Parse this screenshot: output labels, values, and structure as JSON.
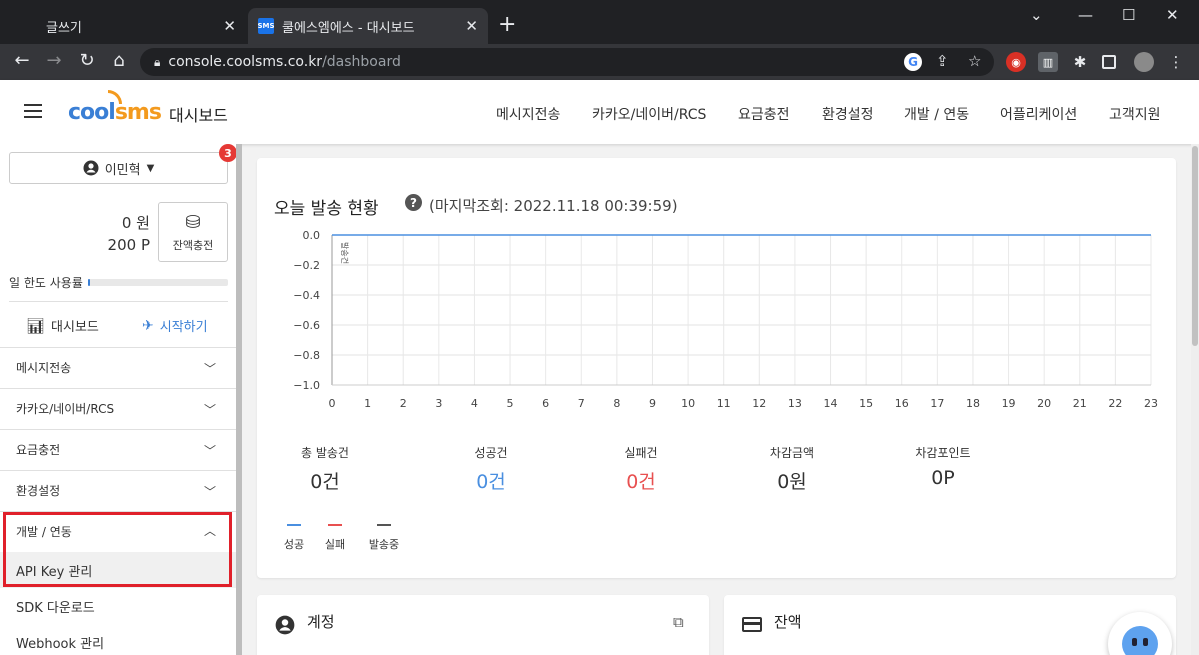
{
  "browser": {
    "tabs": [
      {
        "title": "글쓰기",
        "active": false
      },
      {
        "title": "쿨에스엠에스 - 대시보드",
        "active": true,
        "favicon": "SMS"
      }
    ],
    "url_host": "console.coolsms.co.kr",
    "url_path": "/dashboard"
  },
  "header": {
    "logo_cool": "cool",
    "logo_sms": "sms",
    "title": "대시보드",
    "nav": [
      "메시지전송",
      "카카오/네이버/RCS",
      "요금충전",
      "환경설정",
      "개발 / 연동",
      "어플리케이션",
      "고객지원"
    ]
  },
  "sidebar": {
    "user_name": "이민혁",
    "notification_count": "3",
    "balance_won": "0 원",
    "balance_point": "200 P",
    "recharge_label": "잔액충전",
    "daily_limit_label": "일 한도 사용률",
    "daily_limit_fraction": 0.015,
    "dashboard_label": "대시보드",
    "getting_started_label": "시작하기",
    "menu": [
      {
        "label": "메시지전송",
        "expanded": false
      },
      {
        "label": "카카오/네이버/RCS",
        "expanded": false
      },
      {
        "label": "요금충전",
        "expanded": false
      },
      {
        "label": "환경설정",
        "expanded": false
      },
      {
        "label": "개발 / 연동",
        "expanded": true
      }
    ],
    "submenu": [
      "API Key 관리",
      "SDK 다운로드",
      "Webhook 관리"
    ]
  },
  "status_card": {
    "title": "오늘 발송 현황",
    "last_query": "(마지막조회: 2022.11.18 00:39:59)",
    "stats": [
      {
        "label": "총 발송건",
        "value": "0건",
        "color": "#333333"
      },
      {
        "label": "성공건",
        "value": "0건",
        "color": "#4a8fe0"
      },
      {
        "label": "실패건",
        "value": "0건",
        "color": "#e85050"
      },
      {
        "label": "차감금액",
        "value": "0원",
        "color": "#333333"
      },
      {
        "label": "차감포인트",
        "value": "0P",
        "color": "#333333"
      }
    ],
    "legend": [
      {
        "name": "성공",
        "color": "#4a8fe0"
      },
      {
        "name": "실패",
        "color": "#e85050"
      },
      {
        "name": "발송중",
        "color": "#555555"
      }
    ]
  },
  "chart_data": {
    "type": "line",
    "x": [
      0,
      1,
      2,
      3,
      4,
      5,
      6,
      7,
      8,
      9,
      10,
      11,
      12,
      13,
      14,
      15,
      16,
      17,
      18,
      19,
      20,
      21,
      22,
      23
    ],
    "series": [
      {
        "name": "성공",
        "color": "#4a8fe0",
        "values": [
          0,
          0,
          0,
          0,
          0,
          0,
          0,
          0,
          0,
          0,
          0,
          0,
          0,
          0,
          0,
          0,
          0,
          0,
          0,
          0,
          0,
          0,
          0,
          0
        ]
      }
    ],
    "ylabel": "발송건",
    "ylim": [
      -1.0,
      0.0
    ],
    "yticks": [
      "0.0",
      "−0.2",
      "−0.4",
      "−0.6",
      "−0.8",
      "−1.0"
    ],
    "xticks": [
      "0",
      "1",
      "2",
      "3",
      "4",
      "5",
      "6",
      "7",
      "8",
      "9",
      "10",
      "11",
      "12",
      "13",
      "14",
      "15",
      "16",
      "17",
      "18",
      "19",
      "20",
      "21",
      "22",
      "23"
    ],
    "grid": true
  },
  "account_card": {
    "title": "계정"
  },
  "balance_card": {
    "title": "잔액"
  }
}
